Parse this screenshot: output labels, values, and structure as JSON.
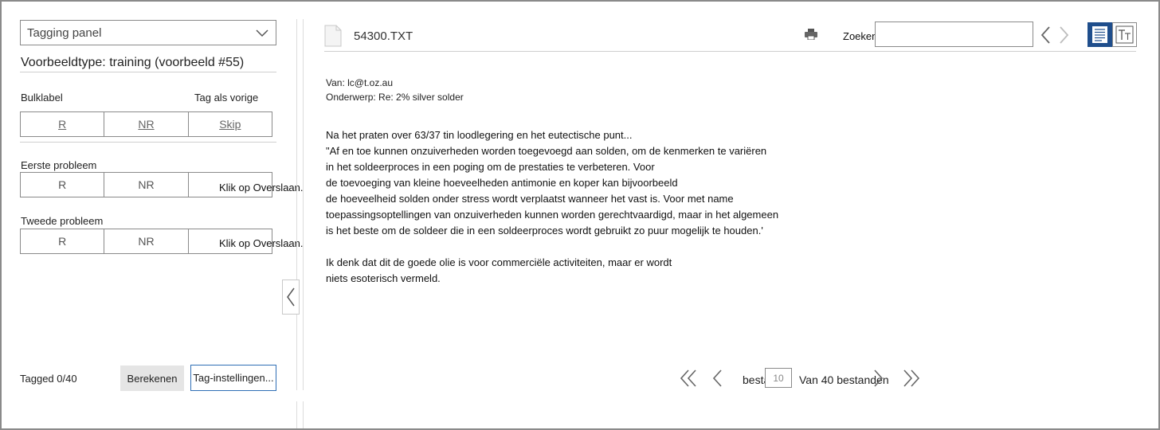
{
  "left_panel": {
    "dropdown_label": "Tagging panel",
    "example_type": "Voorbeeldtype: training (voorbeeld #55)",
    "bulk_label": "Bulklabel",
    "tag_as_previous": "Tag als vorige",
    "bulk_buttons": [
      "R",
      "NR",
      "Skip"
    ],
    "first_problem": {
      "label": "Eerste probleem",
      "buttons": [
        "R",
        "NR"
      ],
      "skip_text": "Klik op Overslaan."
    },
    "second_problem": {
      "label": "Tweede probleem",
      "buttons": [
        "R",
        "NR"
      ],
      "skip_text": "Klik op Overslaan."
    },
    "tagged_status": "Tagged 0/40",
    "compute_button": "Berekenen",
    "settings_button": "Tag-instellingen..."
  },
  "viewer": {
    "file_name": "54300.TXT",
    "search_label": "Zoeken:",
    "search_value": "",
    "icons": {
      "file": "file-icon",
      "print": "printer-icon",
      "prev": "chevron-left-icon",
      "next": "chevron-right-icon",
      "text_view": "text-view-icon",
      "font_view": "font-size-icon"
    },
    "accent_color": "#1f4e8c",
    "document": {
      "from": "Van: lc@t.oz.au",
      "subject": "Onderwerp: Re: 2% silver solder",
      "paragraph1": [
        "Na het praten over 63/37 tin loodlegering en het eutectische punt...",
        "\"Af en toe kunnen onzuiverheden worden toegevoegd aan solden, om de kenmerken te variëren",
        "in het soldeerproces in een poging om de prestaties te verbeteren. Voor",
        "de toevoeging van kleine hoeveelheden antimonie en koper kan bijvoorbeeld",
        "de hoeveelheid solden onder stress wordt verplaatst wanneer het vast is.  Voor met name",
        "toepassingsoptellingen van onzuiverheden kunnen worden gerechtvaardigd, maar in het algemeen",
        "is het beste om de soldeer die in een soldeerproces wordt gebruikt zo puur mogelijk te houden.'"
      ],
      "paragraph2": [
        "Ik denk dat dit de goede olie is voor commerciële activiteiten, maar er wordt",
        "niets esoterisch vermeld."
      ]
    },
    "pager": {
      "file_label": "bestand",
      "page_value": "10",
      "of_files": "Van 40 bestanden"
    }
  }
}
